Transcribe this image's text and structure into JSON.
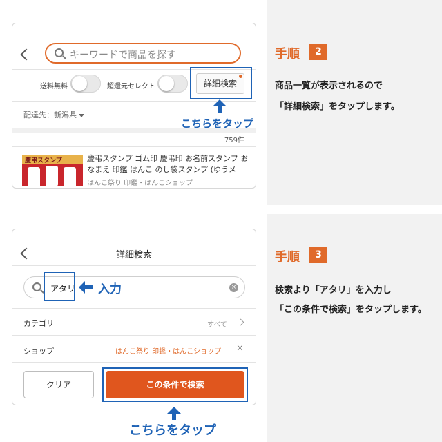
{
  "step2": {
    "search_placeholder": "キーワードで商品を探す",
    "free_shipping_label": "送料無料",
    "super_return_label": "超還元セレクト",
    "detail_button": "詳細検索",
    "delivery_label": "配達先：新潟県",
    "result_count": "759件",
    "product": {
      "thumb_text": "慶弔スタンプ",
      "title": "慶弔スタンプ ゴム印 慶弔印 お名前スタンプ おなまえ 印鑑 はんこ のし袋スタンプ (ゆうメ",
      "shop": "はんこ祭り 印鑑・はんこショップ"
    },
    "tap_label": "こちらをタップ",
    "heading": "手順",
    "number": "2",
    "desc_line1": "商品一覧が表示されるので",
    "desc_line2": "「詳細検索」をタップします。"
  },
  "step3": {
    "title": "詳細検索",
    "search_value": "アタリ",
    "input_label": "入力",
    "category_label": "カテゴリ",
    "category_value": "すべて",
    "shop_label": "ショップ",
    "shop_value": "はんこ祭り 印鑑・はんこショップ",
    "clear_button": "クリア",
    "apply_button": "この条件で検索",
    "tap_label": "こちらをタップ",
    "heading": "手順",
    "number": "3",
    "desc_line1": "検索より「アタリ」を入力し",
    "desc_line2": "「この条件で検索」をタップします。"
  },
  "colors": {
    "accent_orange": "#e06a2a",
    "button_orange": "#e0561e",
    "highlight_blue": "#1f63b6",
    "side_background": "#f2f2f2"
  }
}
